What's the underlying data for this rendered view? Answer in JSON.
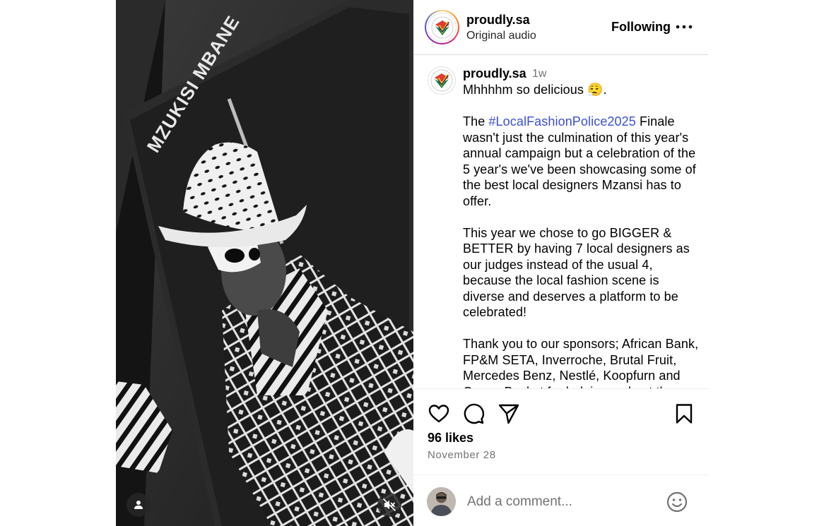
{
  "media": {
    "poster_text": "MZUKISI MBANE"
  },
  "header": {
    "username": "proudly.sa",
    "audio": "Original audio",
    "follow_label": "Following"
  },
  "caption": {
    "username": "proudly.sa",
    "time": "1w",
    "line1": "Mhhhhm so delicious 😮‍💨.",
    "part_before_tag": "\n\nThe ",
    "hashtag": "#LocalFashionPolice2025",
    "part_after_tag": " Finale wasn't just the culmination of this year's annual campaign but a celebration of the 5 year's we've been showcasing some of the best local designers Mzansi has to offer.\n\nThis year we chose to go BIGGER & BETTER by having 7 local designers as our judges instead of the usual 4, because the local fashion scene is diverse and deserves a platform to be celebrated!\n\nThank you to our sponsors; African Bank,  FP&M SETA, Inverroche, Brutal Fruit, Mercedes Benz, Nestlé, Koopfurn and Ocean Basket for helping us host the"
  },
  "stats": {
    "likes": "96 likes",
    "date": "November 28"
  },
  "comment_box": {
    "placeholder": "Add a comment..."
  },
  "icons": {
    "like": "heart-icon",
    "comment": "speech-bubble-icon",
    "share": "paper-plane-icon",
    "save": "bookmark-icon",
    "more": "more-dots-icon",
    "emoji": "smiley-icon",
    "tags": "person-icon",
    "mute": "speaker-muted-icon"
  }
}
